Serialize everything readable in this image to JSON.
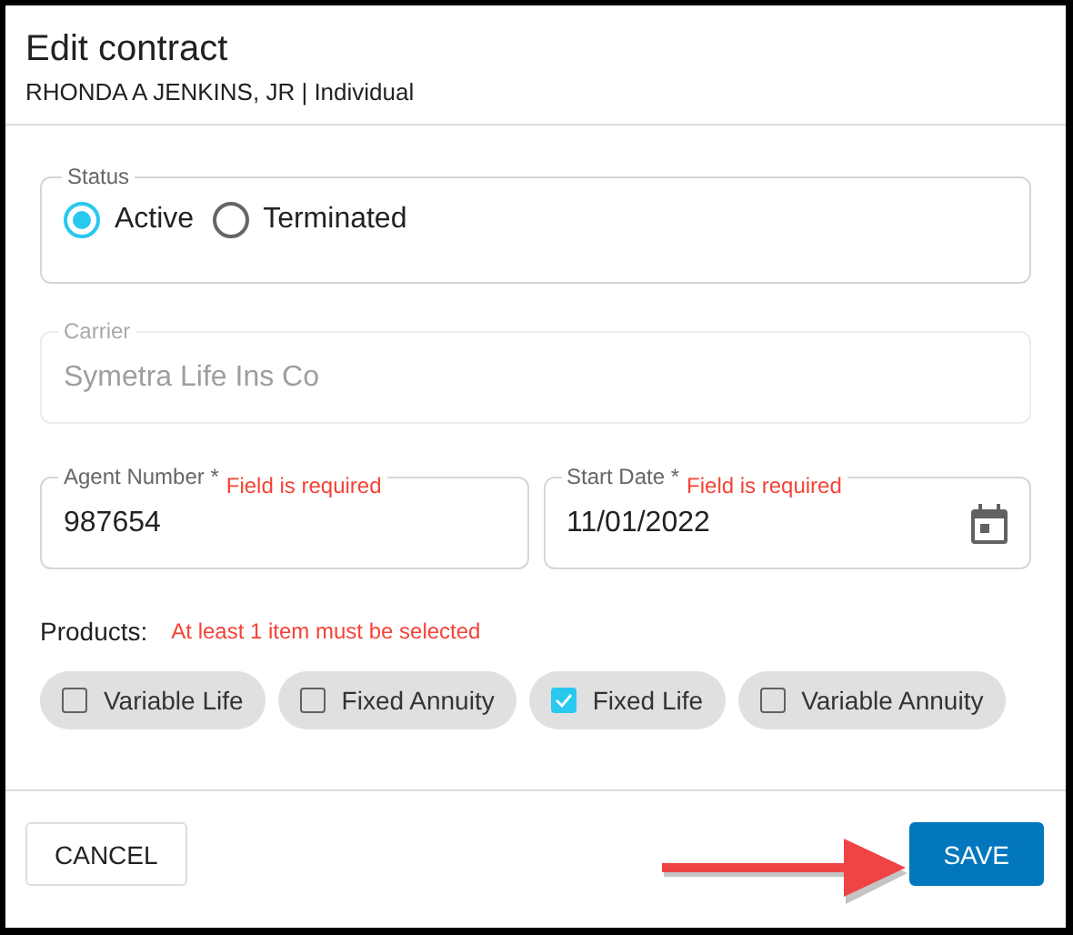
{
  "dialog": {
    "title": "Edit contract",
    "subtitle": "RHONDA A JENKINS, JR | Individual"
  },
  "status": {
    "label": "Status",
    "options": [
      {
        "label": "Active",
        "selected": true
      },
      {
        "label": "Terminated",
        "selected": false
      }
    ]
  },
  "field_rows": [
    {
      "fields": [
        {
          "kind": "text",
          "label": "Carrier",
          "value": "Symetra Life Ins Co",
          "disabled": true
        }
      ]
    },
    {
      "fields": [
        {
          "kind": "text",
          "label": "Agent Number *",
          "error": "Field is required",
          "value": "987654",
          "disabled": false
        },
        {
          "kind": "date",
          "label": "Start Date *",
          "error": "Field is required",
          "value": "11/01/2022",
          "disabled": false
        }
      ]
    }
  ],
  "products": {
    "label": "Products:",
    "error": "At least 1 item must be selected",
    "items": [
      {
        "label": "Variable Life",
        "checked": false
      },
      {
        "label": "Fixed Annuity",
        "checked": false
      },
      {
        "label": "Fixed Life",
        "checked": true
      },
      {
        "label": "Variable Annuity",
        "checked": false
      }
    ]
  },
  "buttons": [
    {
      "kind": "secondary",
      "label": "CANCEL"
    },
    {
      "kind": "primary",
      "label": "SAVE"
    }
  ]
}
